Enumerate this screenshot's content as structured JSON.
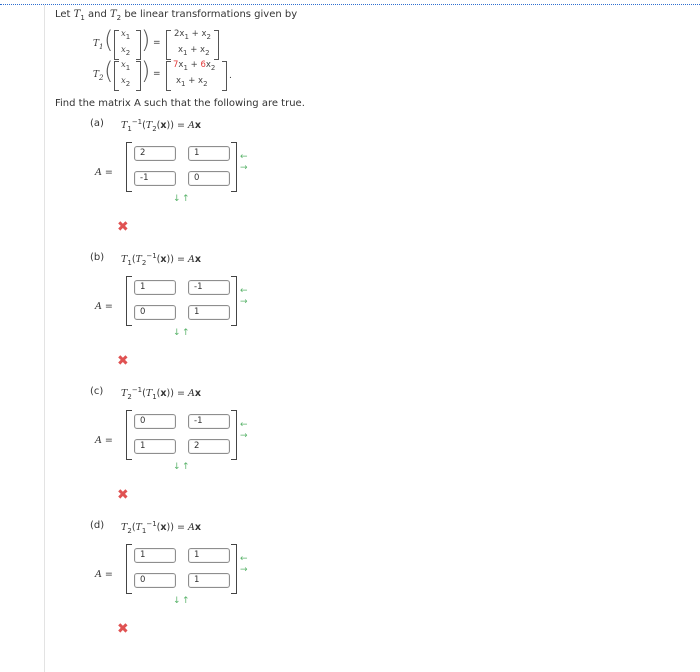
{
  "intro": {
    "let": "Let",
    "t1": "T",
    "t1_sub": "1",
    "and": "and",
    "t2": "T",
    "t2_sub": "2",
    "rest": "be linear transformations given by"
  },
  "def1": {
    "name": "T",
    "sub": "1",
    "x1": "x",
    "x1_sub": "1",
    "x2": "x",
    "x2_sub": "2",
    "eq": "=",
    "r1_a": "2x",
    "r1_a_sub": "1",
    "r1_b": " + x",
    "r1_b_sub": "2",
    "r2_a": "x",
    "r2_a_sub": "1",
    "r2_b": " + x",
    "r2_b_sub": "2"
  },
  "def2": {
    "name": "T",
    "sub": "2",
    "x1": "x",
    "x1_sub": "1",
    "x2": "x",
    "x2_sub": "2",
    "eq": "=",
    "r1_a": "7",
    "r1_a2": "x",
    "r1_a_sub": "1",
    "r1_b": " + ",
    "r1_b2": "6",
    "r1_b3": "x",
    "r1_b_sub": "2",
    "r2_a": "x",
    "r2_a_sub": "1",
    "r2_b": " + x",
    "r2_b_sub": "2",
    "period": "."
  },
  "find_text": "Find the matrix A such that the following are true.",
  "parts": [
    {
      "label": "(a)",
      "t_outer": "T",
      "outer_sub": "1",
      "outer_sup": "−1",
      "t_inner": "T",
      "inner_sub": "2",
      "inner_sup": "",
      "x": "x",
      "close": ")) =",
      "ax": "A",
      "axx": "x",
      "a_eq": "A =",
      "cells": [
        "2",
        "1",
        "-1",
        "0"
      ]
    },
    {
      "label": "(b)",
      "t_outer": "T",
      "outer_sub": "1",
      "outer_sup": "",
      "t_inner": "T",
      "inner_sub": "2",
      "inner_sup": "−1",
      "x": "x",
      "close": ")) =",
      "ax": "A",
      "axx": "x",
      "a_eq": "A =",
      "cells": [
        "1",
        "-1",
        "0",
        "1"
      ]
    },
    {
      "label": "(c)",
      "t_outer": "T",
      "outer_sub": "2",
      "outer_sup": "−1",
      "t_inner": "T",
      "inner_sub": "1",
      "inner_sup": "",
      "x": "x",
      "close": ")) =",
      "ax": "A",
      "axx": "x",
      "a_eq": "A =",
      "cells": [
        "0",
        "-1",
        "1",
        "2"
      ]
    },
    {
      "label": "(d)",
      "t_outer": "T",
      "outer_sub": "2",
      "outer_sup": "",
      "t_inner": "T",
      "inner_sub": "1",
      "inner_sup": "−1",
      "x": "x",
      "close": ")) =",
      "ax": "A",
      "axx": "x",
      "a_eq": "A =",
      "cells": [
        "1",
        "1",
        "0",
        "1"
      ]
    }
  ],
  "icons": {
    "col_arrow_left": "←",
    "col_arrow_right": "→",
    "row_arrow_down": "↓",
    "row_arrow_up": "↑",
    "incorrect": "✖"
  },
  "colors": {
    "highlight": "#e23a3a",
    "arrow": "#59b36a",
    "incorrect": "#e05252"
  }
}
